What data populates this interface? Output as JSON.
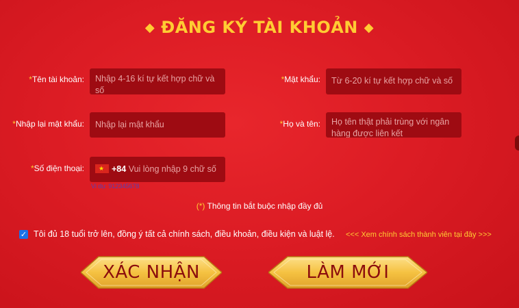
{
  "title": "ĐĂNG KÝ TÀI KHOẢN",
  "title_decoration": "◆",
  "required_mark": "*",
  "form": {
    "username": {
      "label": "Tên tài khoản:",
      "placeholder": "Nhập 4-16 kí tự kết hợp chữ và số"
    },
    "password": {
      "label": "Mật khẩu:",
      "placeholder": "Từ 6-20 kí tự kết hợp chữ và số"
    },
    "confirm_password": {
      "label": "Nhập lại mật khẩu:",
      "placeholder": "Nhập lại mật khẩu"
    },
    "full_name": {
      "label": "Họ và tên:",
      "placeholder": "Họ tên thật phải trùng với ngân hàng được liên kết"
    },
    "phone": {
      "label": "Số điện thoại:",
      "prefix": "+84",
      "placeholder": "Vui lòng nhập 9 chữ số",
      "country_flag": "vietnam-flag-icon",
      "hint": "Vi dụ: 912345678"
    }
  },
  "required_note": {
    "star": "(*)",
    "text": " Thông tin bắt buộc nhập đầy đủ"
  },
  "agreement": {
    "checked": true,
    "text": "Tôi đủ 18 tuổi trở lên, đồng ý tất cả chính sách, điều khoản, điều kiện và luật lệ.",
    "policy_link": "<<< Xem chính sách thành viên tại đây >>>"
  },
  "buttons": {
    "confirm": "XÁC NHẬN",
    "reset": "LÀM MỚI"
  },
  "colors": {
    "background": "#dc1c24",
    "field": "#9e0b12",
    "accent": "#ffcc33",
    "button_gold": "#f5c242",
    "button_text": "#8b0d0d"
  }
}
